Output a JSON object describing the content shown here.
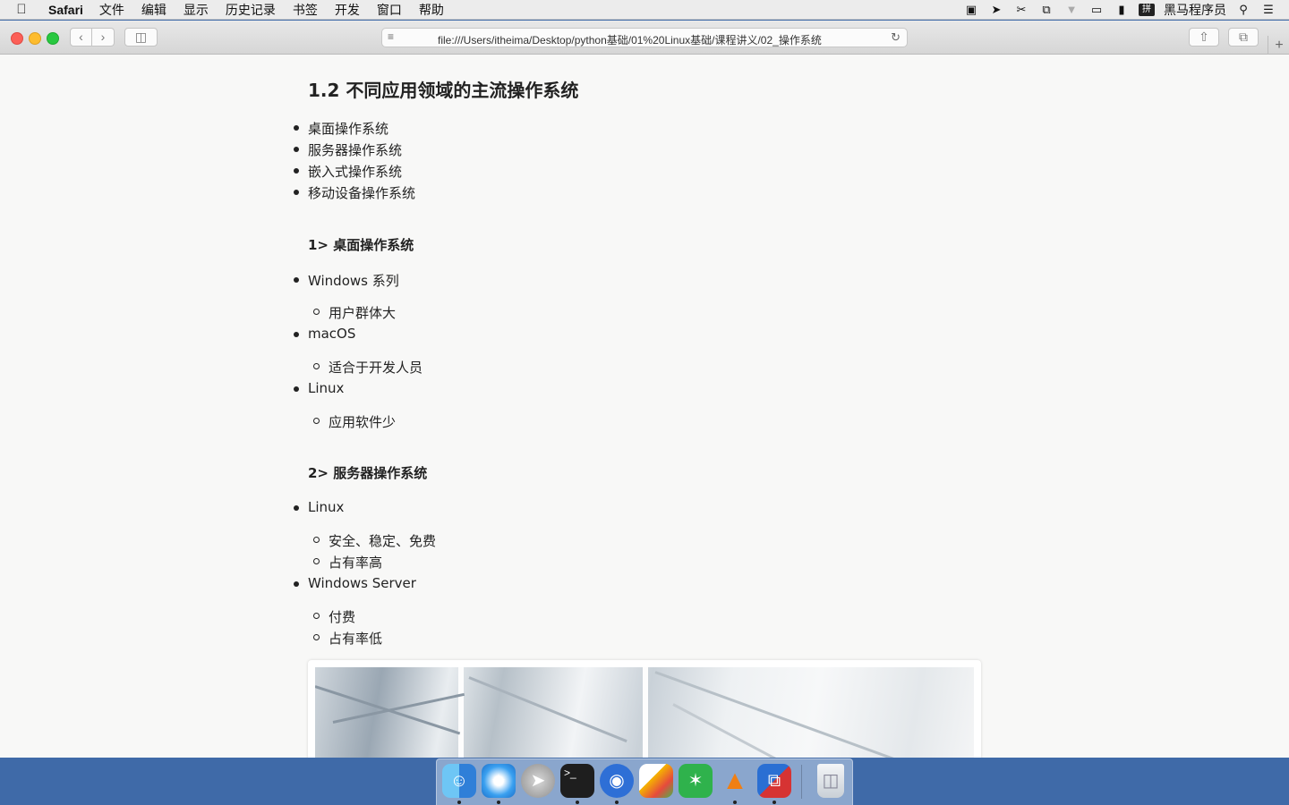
{
  "menubar": {
    "app_name": "Safari",
    "items": [
      "文件",
      "编辑",
      "显示",
      "历史记录",
      "书签",
      "开发",
      "窗口",
      "帮助"
    ],
    "user_name": "黑马程序员"
  },
  "browser": {
    "url": "file:///Users/itheima/Desktop/python基础/01%20Linux基础/课程讲义/02_操作系统"
  },
  "document": {
    "section_title": "1.2 不同应用领域的主流操作系统",
    "overview": [
      "桌面操作系统",
      "服务器操作系统",
      "嵌入式操作系统",
      "移动设备操作系统"
    ],
    "desktop": {
      "heading": "1> 桌面操作系统",
      "items": [
        {
          "name": "Windows 系列",
          "notes": [
            "用户群体大"
          ]
        },
        {
          "name": "macOS",
          "notes": [
            "适合于开发人员"
          ]
        },
        {
          "name": "Linux",
          "notes": [
            "应用软件少"
          ]
        }
      ]
    },
    "server": {
      "heading": "2> 服务器操作系统",
      "items": [
        {
          "name": "Linux",
          "notes": [
            "安全、稳定、免费",
            "占有率高"
          ]
        },
        {
          "name": "Windows Server",
          "notes": [
            "付费",
            "占有率低"
          ]
        }
      ]
    }
  },
  "dock": {
    "apps": [
      "finder",
      "safari",
      "launchpad",
      "terminal",
      "screen-recorder",
      "sketch",
      "xmind",
      "vlc",
      "parallels",
      "trash"
    ]
  },
  "colors": {
    "desktop": "#3f6aa8",
    "close": "#fc5f57",
    "minimize": "#fdbc2e",
    "zoom": "#28c840"
  }
}
